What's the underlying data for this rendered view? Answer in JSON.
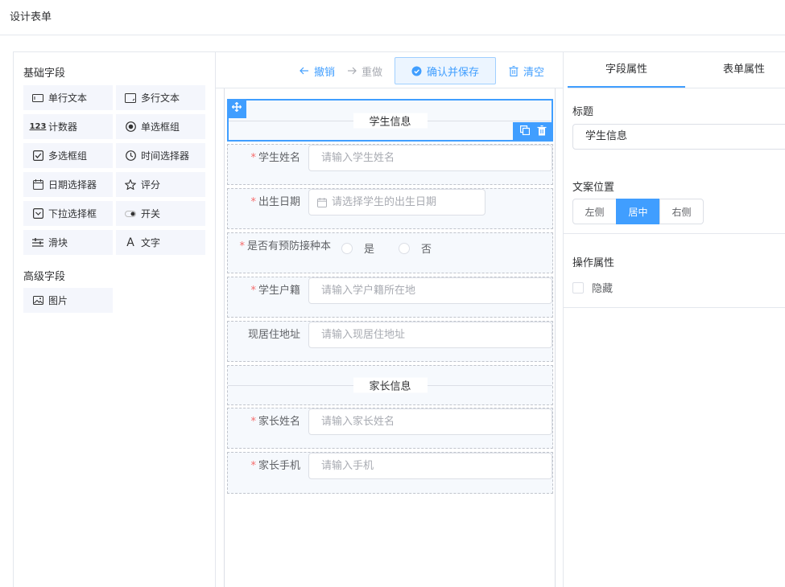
{
  "page": {
    "title": "设计表单"
  },
  "left": {
    "basic_title": "基础字段",
    "advanced_title": "高级字段",
    "basic_fields": [
      {
        "label": "单行文本",
        "icon": "single-line-text-icon"
      },
      {
        "label": "多行文本",
        "icon": "multi-line-text-icon"
      },
      {
        "label": "计数器",
        "icon": "counter-icon"
      },
      {
        "label": "单选框组",
        "icon": "radio-icon"
      },
      {
        "label": "多选框组",
        "icon": "checkbox-icon"
      },
      {
        "label": "时间选择器",
        "icon": "clock-icon"
      },
      {
        "label": "日期选择器",
        "icon": "calendar-icon"
      },
      {
        "label": "评分",
        "icon": "star-icon"
      },
      {
        "label": "下拉选择框",
        "icon": "select-icon"
      },
      {
        "label": "开关",
        "icon": "switch-icon"
      },
      {
        "label": "滑块",
        "icon": "slider-icon"
      },
      {
        "label": "文字",
        "icon": "text-icon"
      }
    ],
    "advanced_fields": [
      {
        "label": "图片",
        "icon": "image-icon"
      }
    ]
  },
  "toolbar": {
    "undo_label": "撤销",
    "redo_label": "重做",
    "save_label": "确认并保存",
    "clear_label": "清空"
  },
  "canvas": {
    "section_student": "学生信息",
    "section_parent": "家长信息",
    "fields": {
      "student_name": {
        "label": "学生姓名",
        "placeholder": "请输入学生姓名",
        "required": "*"
      },
      "birth_date": {
        "label": "出生日期",
        "placeholder": "请选择学生的出生日期",
        "required": "*"
      },
      "vaccinated": {
        "label": "是否有预防接种本",
        "required": "*",
        "options": [
          "是",
          "否"
        ]
      },
      "household": {
        "label": "学生户籍",
        "placeholder": "请输入学户籍所在地",
        "required": "*"
      },
      "address": {
        "label": "现居住地址",
        "placeholder": "请输入现居住地址"
      },
      "parent_name": {
        "label": "家长姓名",
        "placeholder": "请输入家长姓名",
        "required": "*"
      },
      "parent_phone": {
        "label": "家长手机",
        "placeholder": "请输入手机",
        "required": "*"
      }
    }
  },
  "right": {
    "tab_field": "字段属性",
    "tab_form": "表单属性",
    "title_label": "标题",
    "title_value": "学生信息",
    "text_position_label": "文案位置",
    "position_options": [
      "左侧",
      "居中",
      "右侧"
    ],
    "position_selected": "居中",
    "action_label": "操作属性",
    "hidden_label": "隐藏"
  },
  "colors": {
    "accent": "#409eff",
    "required": "#f56c6c",
    "field_bg": "#f4f6fc",
    "border": "#dcdfe6"
  }
}
